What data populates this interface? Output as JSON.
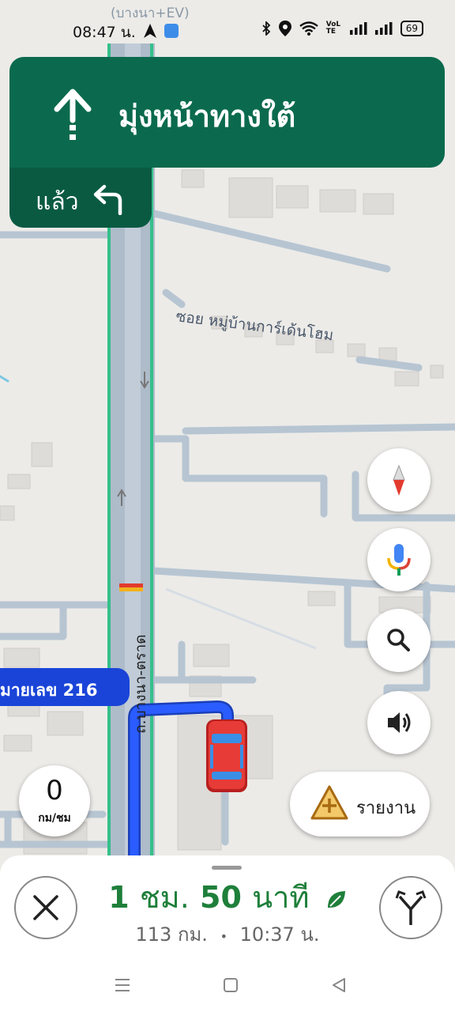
{
  "status_bar": {
    "time": "08:47 น.",
    "network_label": "VoLTE",
    "battery": "69"
  },
  "map": {
    "top_label": "(บางนา+EV)",
    "street_label": "ซอย หมู่บ้านการ์เด้นโฮม",
    "main_road_label": "ถ.บางนา-ตราด"
  },
  "navigation": {
    "instruction": "มุ่งหน้าทางใต้",
    "then_label": "แล้ว",
    "maneuver_icon": "arrow-straight-icon",
    "then_icon": "turn-left-icon"
  },
  "road_chip": {
    "label": "มายเลข 216"
  },
  "speed": {
    "value": "0",
    "unit": "กม/ชม"
  },
  "buttons": {
    "compass": "compass-icon",
    "voice": "microphone-icon",
    "search": "search-icon",
    "sound": "speaker-icon",
    "report": "รายงาน"
  },
  "trip": {
    "eta_hours": "1",
    "hours_unit": "ชม.",
    "eta_minutes": "50",
    "minutes_unit": "นาที",
    "distance": "113 กม.",
    "separator": "•",
    "arrival": "10:37 น."
  },
  "colors": {
    "nav_green": "#0b6a4d",
    "route_blue": "#1a44d8",
    "eta_green": "#1e7f3a"
  }
}
